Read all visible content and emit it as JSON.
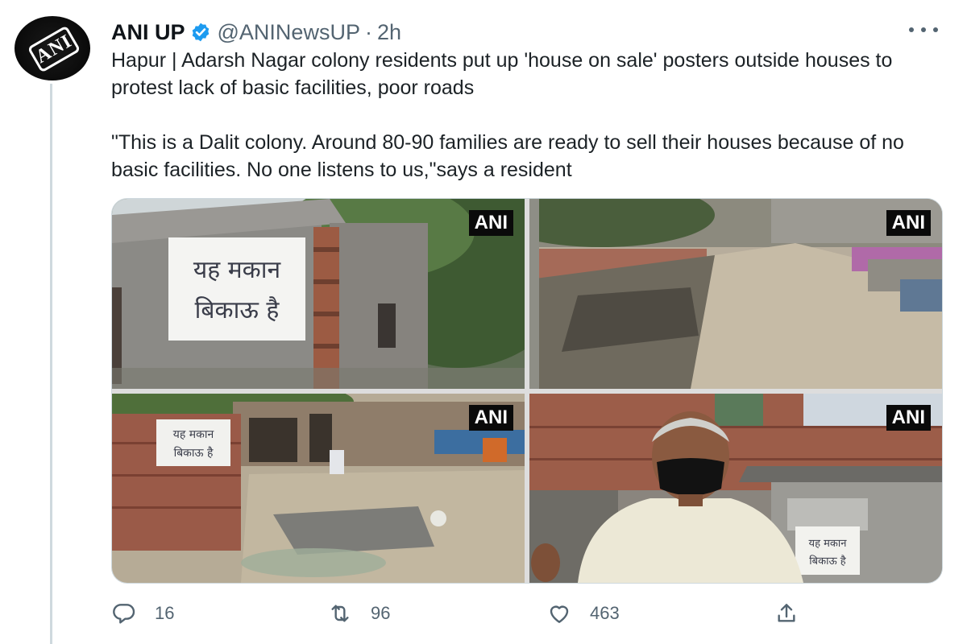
{
  "author": {
    "name": "ANI UP",
    "handle": "@ANINewsUP",
    "separator": "·",
    "time": "2h",
    "avatar_text": "ANI"
  },
  "tweet": {
    "paragraph1": "Hapur | Adarsh Nagar colony residents put up 'house on sale' posters outside houses to protest lack of basic facilities, poor roads",
    "paragraph2": "\"This is a Dalit colony. Around 80-90 families are ready to sell their houses because of no basic facilities. No one listens to us,\"says a resident"
  },
  "media": {
    "watermark": "ANI",
    "photos": [
      {
        "sign_text": "यह मकान बिकाऊ है"
      },
      {},
      {
        "sign_text": "यह मकान बिकाऊ है"
      },
      {
        "sign_text": "यह मकान बिकाऊ है"
      }
    ]
  },
  "actions": {
    "replies": "16",
    "retweets": "96",
    "likes": "463"
  },
  "icons": {
    "verified": "verified-badge-icon",
    "more": "more-icon",
    "reply": "reply-icon",
    "retweet": "retweet-icon",
    "like": "heart-icon",
    "share": "share-icon"
  },
  "colors": {
    "verified": "#1d9bf0",
    "secondary_text": "#536471",
    "text": "#0f1419"
  }
}
